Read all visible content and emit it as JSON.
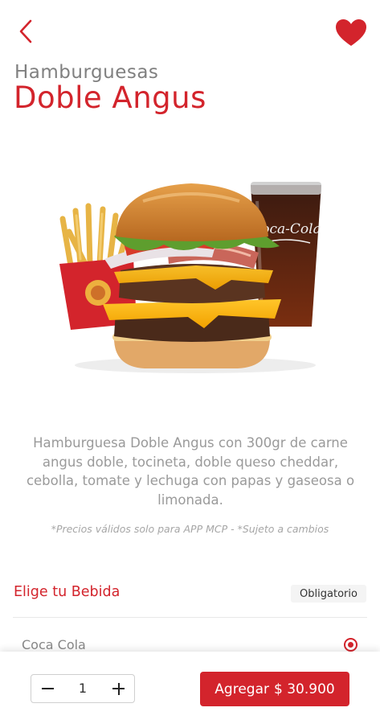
{
  "header": {
    "back_icon": "chevron-left-icon",
    "favorite_icon": "heart-icon",
    "accent_color": "#d3242c"
  },
  "product": {
    "category": "Hamburguesas",
    "name": "Doble Angus",
    "cup_logo": "Coca-Cola",
    "description": "Hamburguesa Doble Angus con 300gr de carne angus doble, tocineta, doble queso cheddar, cebolla, tomate y lechuga con papas y gaseosa o limonada.",
    "disclaimer": "*Precios válidos solo para APP MCP - *Sujeto a cambios"
  },
  "drink_section": {
    "title": "Elige tu Bebida",
    "badge": "Obligatorio",
    "options": [
      {
        "label": "Coca Cola",
        "selected": true
      }
    ]
  },
  "order": {
    "quantity": "1",
    "add_label": "Agregar",
    "price": "$ 30.900"
  }
}
